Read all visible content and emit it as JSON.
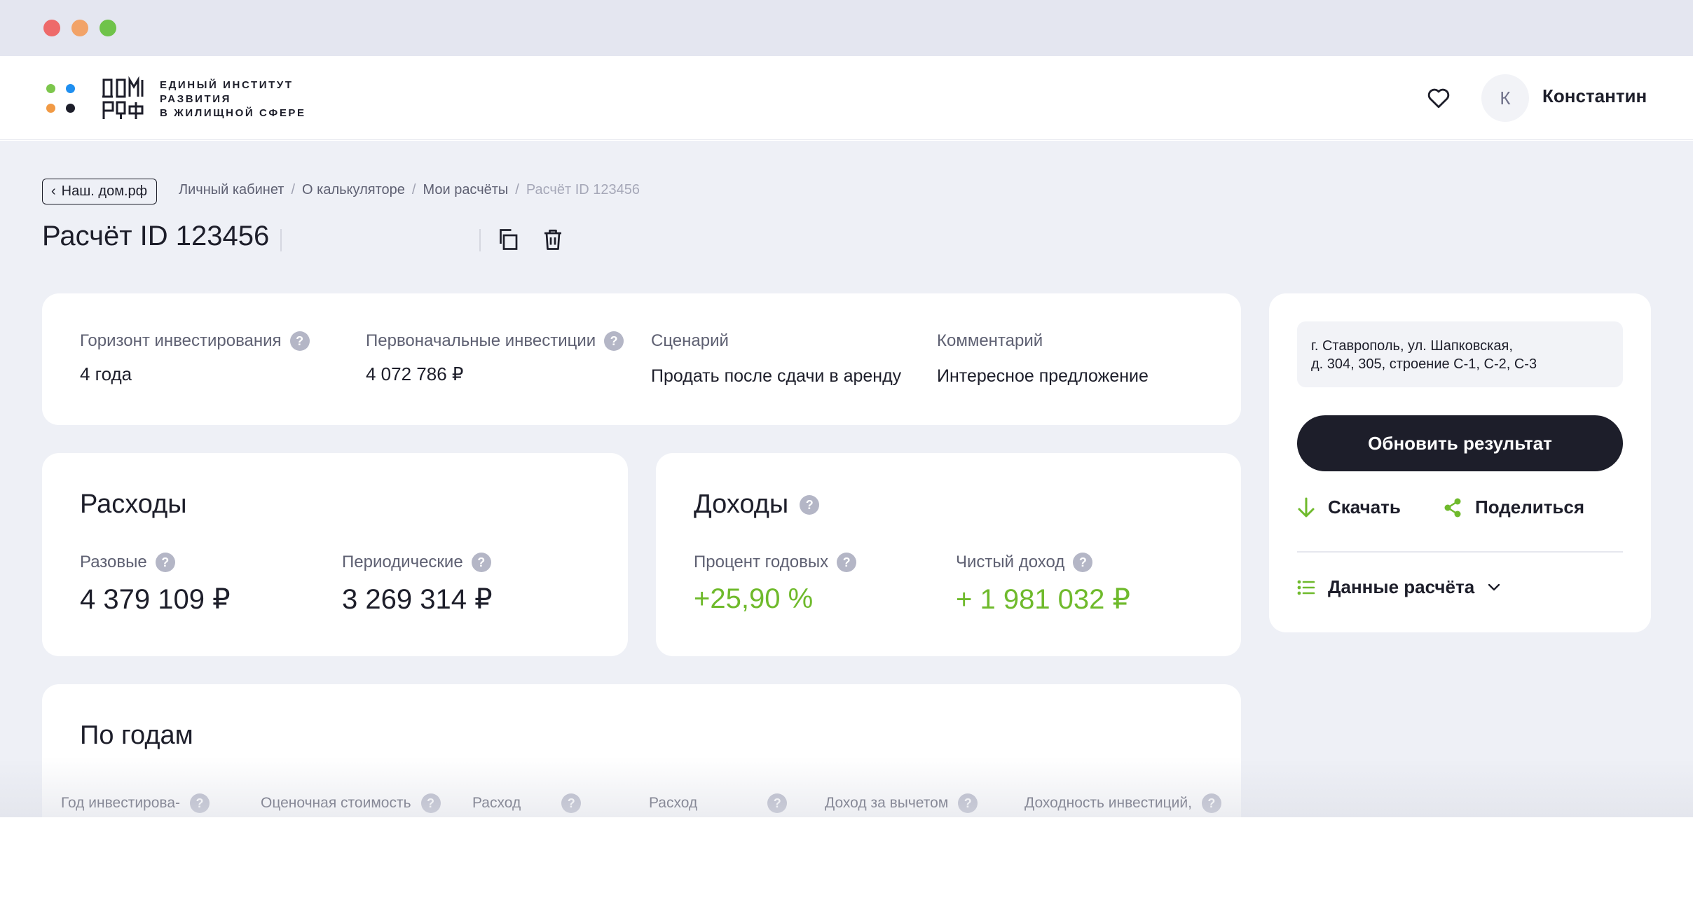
{
  "window": {
    "controls": [
      "close",
      "minimize",
      "maximize"
    ]
  },
  "logo": {
    "mark_text": "ДОМ РФ",
    "lines": [
      "ЕДИНЫЙ ИНСТИТУТ",
      "РАЗВИТИЯ",
      "В ЖИЛИЩНОЙ СФЕРЕ"
    ]
  },
  "user": {
    "initial": "К",
    "name": "Константин"
  },
  "nav": {
    "back_label": "Наш. дом.рф",
    "breadcrumbs": [
      "Личный кабинет",
      "О калькуляторе",
      "Мои расчёты"
    ],
    "breadcrumb_current": "Расчёт ID 123456",
    "separator": "/"
  },
  "page": {
    "title": "Расчёт ID 123456"
  },
  "summary": {
    "horizon": {
      "label": "Горизонт инвестирования",
      "value": "4 года"
    },
    "initial": {
      "label": "Первоначальные инвестиции",
      "value": "4 072 786 ₽"
    },
    "scenario": {
      "label": "Сценарий",
      "value": "Продать после сдачи в аренду"
    },
    "comment": {
      "label": "Комментарий",
      "value": "Интересное предложение"
    }
  },
  "expenses": {
    "title": "Расходы",
    "one_time": {
      "label": "Разовые",
      "value": "4 379 109 ₽"
    },
    "periodic": {
      "label": "Периодические",
      "value": "3 269 314 ₽"
    }
  },
  "income": {
    "title": "Доходы",
    "annual": {
      "label": "Процент годовых",
      "value": "+25,90 %"
    },
    "net": {
      "label": "Чистый доход",
      "value": "+ 1 981 032 ₽"
    }
  },
  "years": {
    "title": "По годам",
    "columns": [
      "Год инвестирова-",
      "Оценочная стоимость",
      "Расход",
      "Расход",
      "Доход за вычетом",
      "Доходность инвестиций,"
    ]
  },
  "sidebar": {
    "address_lines": [
      "г. Ставрополь, ул. Шапковская,",
      "д. 304, 305,  строение С-1, С-2, С-3"
    ],
    "update_label": "Обновить результат",
    "download_label": "Скачать",
    "share_label": "Поделиться",
    "calc_data_label": "Данные расчёта"
  },
  "help_glyph": "?",
  "colors": {
    "accent_green": "#6fba2c",
    "dark": "#1d1e2a",
    "background": "#eef0f6"
  }
}
